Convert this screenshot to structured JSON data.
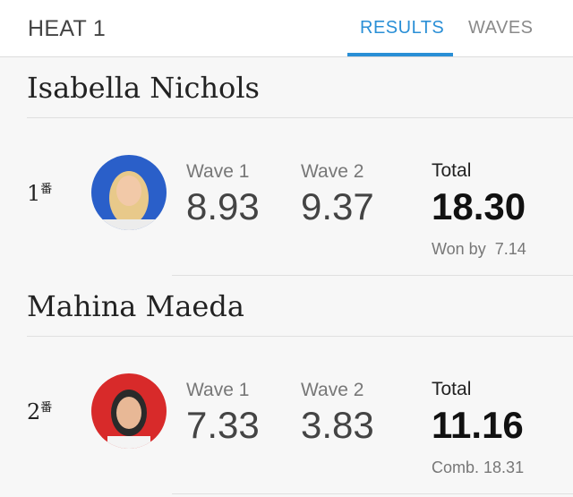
{
  "header": {
    "heat_title": "HEAT 1",
    "tabs": [
      {
        "label": "RESULTS",
        "active": true
      },
      {
        "label": "WAVES",
        "active": false
      }
    ],
    "accent_color": "#2a8fd6"
  },
  "results": [
    {
      "name": "Isabella Nichols",
      "rank": "1",
      "rank_suffix": "番",
      "avatar_bg": "#2a5fc9",
      "wave1_label": "Wave 1",
      "wave1_score": "8.93",
      "wave2_label": "Wave 2",
      "wave2_score": "9.37",
      "total_label": "Total",
      "total_score": "18.30",
      "note_label": "Won by",
      "note_value": "7.14"
    },
    {
      "name": "Mahina Maeda",
      "rank": "2",
      "rank_suffix": "番",
      "avatar_bg": "#d82a2a",
      "wave1_label": "Wave 1",
      "wave1_score": "7.33",
      "wave2_label": "Wave 2",
      "wave2_score": "3.83",
      "total_label": "Total",
      "total_score": "11.16",
      "note_label": "Comb.",
      "note_value": "18.31"
    }
  ]
}
